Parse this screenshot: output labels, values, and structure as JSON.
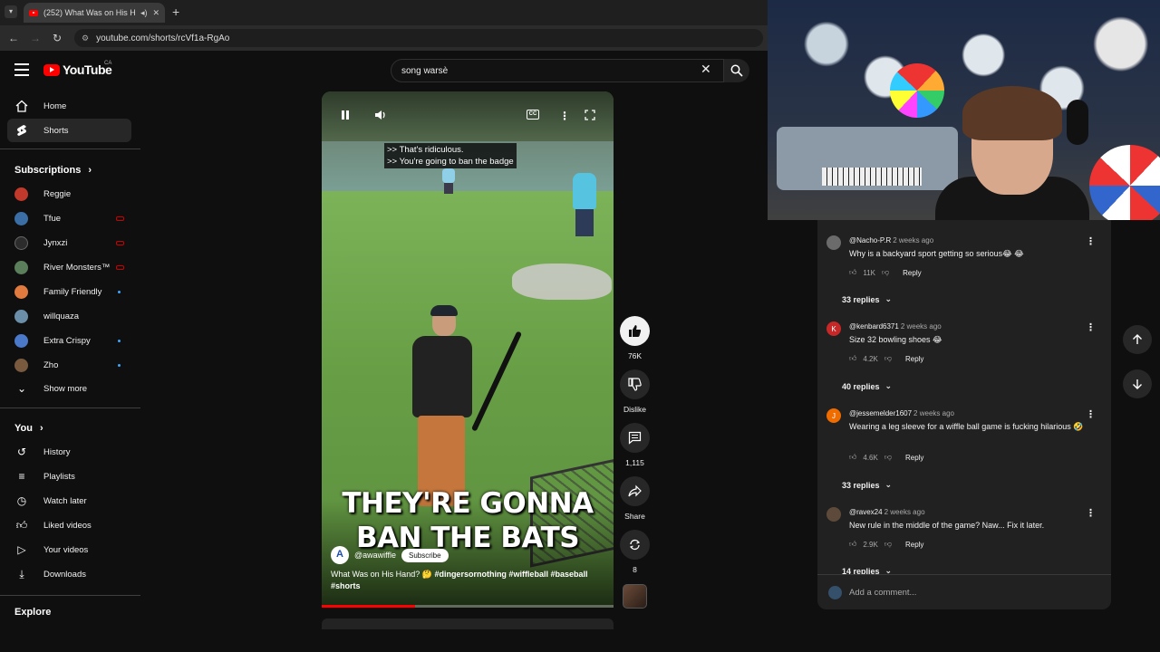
{
  "browser": {
    "tab_title": "(252) What Was on His Han",
    "url": "youtube.com/shorts/rcVf1a-RgAo"
  },
  "header": {
    "logo_text": "YouTube",
    "country": "CA",
    "search_value": "song warsè"
  },
  "sidebar": {
    "main": [
      {
        "label": "Home",
        "icon": "home-icon"
      },
      {
        "label": "Shorts",
        "icon": "shorts-icon",
        "active": true
      }
    ],
    "subscriptions_title": "Subscriptions",
    "subscriptions": [
      {
        "label": "Reggie",
        "color": "#c0392b",
        "badge": ""
      },
      {
        "label": "Tfue",
        "color": "#3a6ea5",
        "badge": "live"
      },
      {
        "label": "Jynxzi",
        "color": "#2c2c2c",
        "badge": "live"
      },
      {
        "label": "River Monsters™",
        "color": "#5b7f5a",
        "badge": "live"
      },
      {
        "label": "Family Friendly",
        "color": "#e07a3f",
        "badge": "new"
      },
      {
        "label": "willquaza",
        "color": "#6b8fa8",
        "badge": ""
      },
      {
        "label": "Extra Crispy",
        "color": "#4a79c9",
        "badge": "new"
      },
      {
        "label": "Zho",
        "color": "#7a5a3f",
        "badge": "new"
      }
    ],
    "show_more": "Show more",
    "you_title": "You",
    "you_items": [
      {
        "label": "History",
        "icon": "history-icon"
      },
      {
        "label": "Playlists",
        "icon": "playlists-icon"
      },
      {
        "label": "Watch later",
        "icon": "watch-later-icon"
      },
      {
        "label": "Liked videos",
        "icon": "liked-icon"
      },
      {
        "label": "Your videos",
        "icon": "your-videos-icon"
      },
      {
        "label": "Downloads",
        "icon": "downloads-icon"
      }
    ],
    "explore_title": "Explore"
  },
  "video": {
    "captions": [
      ">> That's ridiculous.",
      ">> You're going to ban the badge"
    ],
    "overlay_line1": "THEY'RE GONNA",
    "overlay_line2": "BAN THE BATS",
    "channel": "@awawiffle",
    "subscribe": "Subscribe",
    "title_prefix": "What Was on His Hand? 🤔",
    "hashtags": "#dingersornothing #wiffleball #baseball",
    "hashtag_shorts": "#shorts",
    "progress_fraction": 0.32
  },
  "actions": {
    "likes": "76K",
    "dislike": "Dislike",
    "comments": "1,115",
    "share": "Share",
    "remix": "8"
  },
  "comments": [
    {
      "user": "@Nacho-P.R",
      "time": "2 weeks ago",
      "text": "Why is a backyard sport getting so serious😂 😂",
      "likes": "11K",
      "replies": "33 replies",
      "avatar_color": "#6b6b6b",
      "initial": ""
    },
    {
      "user": "@kenbard6371",
      "time": "2 weeks ago",
      "text": "Size 32 bowling shoes 😂",
      "likes": "4.2K",
      "replies": "40 replies",
      "avatar_color": "#c62828",
      "initial": "K"
    },
    {
      "user": "@jessemelder1607",
      "time": "2 weeks ago",
      "text": "Wearing a leg sleeve for a wiffle ball game is fucking hilarious 🤣",
      "likes": "4.6K",
      "replies": "33 replies",
      "avatar_color": "#ef6c00",
      "initial": "J"
    },
    {
      "user": "@ravex24",
      "time": "2 weeks ago",
      "text": "New rule in the middle of the game? Naw... Fix it later.",
      "likes": "2.9K",
      "replies": "14 replies",
      "avatar_color": "#5d4a3a",
      "initial": ""
    }
  ],
  "reply_label": "Reply",
  "add_comment_placeholder": "Add a comment..."
}
